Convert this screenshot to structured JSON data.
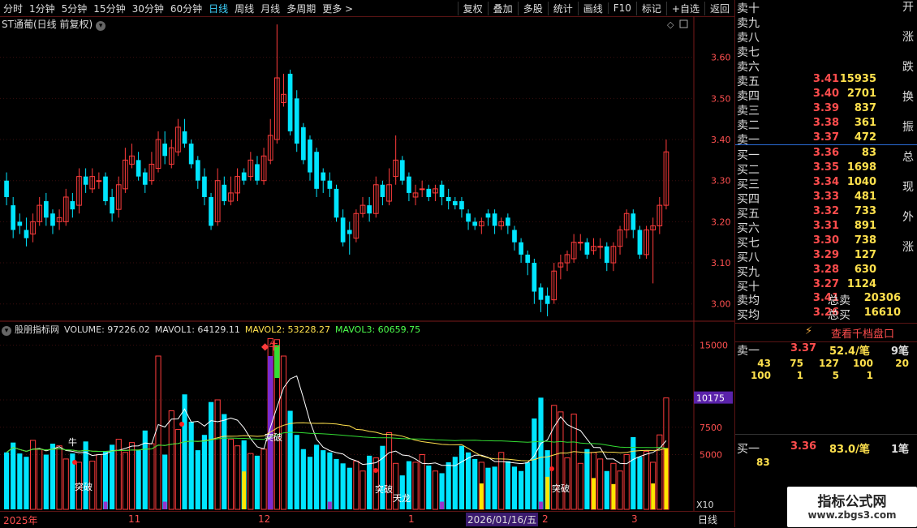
{
  "toolbar": {
    "periods": [
      "分时",
      "1分钟",
      "5分钟",
      "15分钟",
      "30分钟",
      "60分钟",
      "日线",
      "周线",
      "月线",
      "多周期",
      "更多 >"
    ],
    "active": "日线",
    "right": [
      "复权",
      "叠加",
      "多股",
      "统计",
      "画线",
      "F10",
      "标记",
      "+自选",
      "返回"
    ]
  },
  "main_title": "ST通葡(日线 前复权)",
  "indicator": {
    "name": "股朋指标网",
    "volume": "VOLUME: 97226.02",
    "mavol1": "MAVOL1: 64129.11",
    "mavol2": "MAVOL2: 53228.27",
    "mavol3": "MAVOL3: 60659.75",
    "last_value": "10175",
    "axis_unit": "X10"
  },
  "price_axis": [
    "3.60",
    "3.50",
    "3.40",
    "3.30",
    "3.20",
    "3.10",
    "3.00"
  ],
  "vol_axis": [
    "15000",
    "10000",
    "7500",
    "5000"
  ],
  "orderbook": {
    "asks": [
      {
        "label": "卖十",
        "price": "",
        "vol": ""
      },
      {
        "label": "卖九",
        "price": "",
        "vol": ""
      },
      {
        "label": "卖八",
        "price": "",
        "vol": ""
      },
      {
        "label": "卖七",
        "price": "",
        "vol": ""
      },
      {
        "label": "卖六",
        "price": "",
        "vol": ""
      },
      {
        "label": "卖五",
        "price": "3.41",
        "vol": "15935"
      },
      {
        "label": "卖四",
        "price": "3.40",
        "vol": "2701"
      },
      {
        "label": "卖三",
        "price": "3.39",
        "vol": "837"
      },
      {
        "label": "卖二",
        "price": "3.38",
        "vol": "361"
      },
      {
        "label": "卖一",
        "price": "3.37",
        "vol": "472"
      }
    ],
    "bids": [
      {
        "label": "买一",
        "price": "3.36",
        "vol": "83"
      },
      {
        "label": "买二",
        "price": "3.35",
        "vol": "1698"
      },
      {
        "label": "买三",
        "price": "3.34",
        "vol": "1040"
      },
      {
        "label": "买四",
        "price": "3.33",
        "vol": "481"
      },
      {
        "label": "买五",
        "price": "3.32",
        "vol": "733"
      },
      {
        "label": "买六",
        "price": "3.31",
        "vol": "891"
      },
      {
        "label": "买七",
        "price": "3.30",
        "vol": "738"
      },
      {
        "label": "买八",
        "price": "3.29",
        "vol": "127"
      },
      {
        "label": "买九",
        "price": "3.28",
        "vol": "630"
      },
      {
        "label": "买十",
        "price": "3.27",
        "vol": "1124"
      }
    ],
    "ask_avg": {
      "label": "卖均",
      "price": "3.41",
      "total_label": "总卖",
      "total": "20306"
    },
    "bid_avg": {
      "label": "买均",
      "price": "3.26",
      "total_label": "总买",
      "total": "16610"
    },
    "view_button": "查看千档盘口",
    "sell1": {
      "label": "卖一",
      "price": "3.37",
      "per": "52.4/笔",
      "count": "9笔",
      "orders_row1": [
        "43",
        "75",
        "127",
        "100",
        "20"
      ],
      "orders_row2": [
        "100",
        "1",
        "5",
        "1"
      ]
    },
    "buy1": {
      "label": "买一",
      "price": "3.36",
      "per": "83.0/笔",
      "count": "1笔",
      "orders_row1": [
        "83"
      ]
    }
  },
  "side_text": "开涨跌换振总现外涨",
  "dates": {
    "y2025": "2025年",
    "m11": "11",
    "m12": "12",
    "m1": "1",
    "hl": "2026/01/16/五",
    "m2": "2",
    "m3": "3",
    "kday": "日线"
  },
  "signals": {
    "niu": "牛",
    "tupo": "突破",
    "tianlong": "天龙"
  },
  "watermark": {
    "title": "指标公式网",
    "url": "www.zbgs3.com"
  },
  "chart_data": {
    "type": "candlestick",
    "open": [
      3.3,
      3.24,
      3.2,
      3.18,
      3.17,
      3.2,
      3.25,
      3.22,
      3.2,
      3.2,
      3.25,
      3.24,
      3.31,
      3.28,
      3.3,
      3.31,
      3.26,
      3.23,
      3.28,
      3.34,
      3.35,
      3.32,
      3.3,
      3.33,
      3.39,
      3.34,
      3.37,
      3.42,
      3.39,
      3.35,
      3.31,
      3.26,
      3.2,
      3.29,
      3.25,
      3.27,
      3.32,
      3.31,
      3.34,
      3.3,
      3.35,
      3.4,
      3.49,
      3.56,
      3.5,
      3.43,
      3.4,
      3.37,
      3.32,
      3.3,
      3.28,
      3.21,
      3.18,
      3.16,
      3.22,
      3.24,
      3.22,
      3.29,
      3.25,
      3.31,
      3.35,
      3.31,
      3.26,
      3.28,
      3.28,
      3.27,
      3.29,
      3.26,
      3.25,
      3.25,
      3.22,
      3.2,
      3.19,
      3.22,
      3.22,
      3.19,
      3.21,
      3.18,
      3.15,
      3.12,
      3.1,
      3.04,
      3.02,
      3.01,
      3.09,
      3.1,
      3.11,
      3.15,
      3.15,
      3.13,
      3.14,
      3.14,
      3.1,
      3.14,
      3.18,
      3.22,
      3.18,
      3.12,
      3.18,
      3.19,
      3.24
    ],
    "close": [
      3.26,
      3.18,
      3.19,
      3.16,
      3.2,
      3.24,
      3.21,
      3.19,
      3.21,
      3.26,
      3.23,
      3.31,
      3.29,
      3.31,
      3.3,
      3.25,
      3.22,
      3.29,
      3.35,
      3.36,
      3.31,
      3.29,
      3.34,
      3.4,
      3.36,
      3.38,
      3.43,
      3.39,
      3.34,
      3.3,
      3.26,
      3.19,
      3.3,
      3.25,
      3.27,
      3.31,
      3.3,
      3.35,
      3.3,
      3.36,
      3.41,
      3.55,
      3.51,
      3.42,
      3.39,
      3.35,
      3.32,
      3.28,
      3.3,
      3.28,
      3.21,
      3.15,
      3.17,
      3.22,
      3.24,
      3.22,
      3.29,
      3.26,
      3.29,
      3.35,
      3.3,
      3.27,
      3.27,
      3.28,
      3.26,
      3.28,
      3.26,
      3.25,
      3.24,
      3.23,
      3.2,
      3.19,
      3.2,
      3.21,
      3.19,
      3.2,
      3.19,
      3.15,
      3.12,
      3.1,
      3.03,
      3.01,
      3.0,
      3.08,
      3.1,
      3.12,
      3.15,
      3.15,
      3.12,
      3.14,
      3.14,
      3.1,
      3.14,
      3.18,
      3.22,
      3.18,
      3.12,
      3.18,
      3.19,
      3.24,
      3.37
    ],
    "high": [
      3.32,
      3.26,
      3.22,
      3.21,
      3.22,
      3.26,
      3.27,
      3.23,
      3.23,
      3.28,
      3.27,
      3.33,
      3.33,
      3.33,
      3.32,
      3.32,
      3.28,
      3.31,
      3.38,
      3.39,
      3.37,
      3.33,
      3.37,
      3.42,
      3.42,
      3.4,
      3.45,
      3.45,
      3.4,
      3.36,
      3.33,
      3.27,
      3.33,
      3.31,
      3.31,
      3.33,
      3.33,
      3.37,
      3.36,
      3.38,
      3.45,
      3.68,
      3.56,
      3.57,
      3.52,
      3.44,
      3.41,
      3.38,
      3.33,
      3.32,
      3.29,
      3.23,
      3.2,
      3.23,
      3.26,
      3.26,
      3.31,
      3.3,
      3.33,
      3.41,
      3.36,
      3.32,
      3.29,
      3.3,
      3.29,
      3.29,
      3.3,
      3.28,
      3.26,
      3.26,
      3.23,
      3.21,
      3.21,
      3.23,
      3.23,
      3.21,
      3.22,
      3.19,
      3.16,
      3.13,
      3.11,
      3.05,
      3.04,
      3.1,
      3.12,
      3.13,
      3.17,
      3.17,
      3.16,
      3.16,
      3.16,
      3.15,
      3.15,
      3.19,
      3.23,
      3.23,
      3.19,
      3.19,
      3.21,
      3.26,
      3.4
    ],
    "low": [
      3.24,
      3.16,
      3.17,
      3.14,
      3.15,
      3.19,
      3.19,
      3.17,
      3.18,
      3.19,
      3.21,
      3.22,
      3.27,
      3.27,
      3.28,
      3.24,
      3.2,
      3.21,
      3.27,
      3.33,
      3.3,
      3.27,
      3.29,
      3.32,
      3.34,
      3.33,
      3.36,
      3.38,
      3.33,
      3.28,
      3.24,
      3.18,
      3.19,
      3.24,
      3.24,
      3.25,
      3.29,
      3.3,
      3.29,
      3.29,
      3.34,
      3.39,
      3.48,
      3.41,
      3.37,
      3.34,
      3.3,
      3.26,
      3.27,
      3.26,
      3.2,
      3.14,
      3.12,
      3.15,
      3.21,
      3.2,
      3.21,
      3.24,
      3.24,
      3.29,
      3.29,
      3.25,
      3.24,
      3.26,
      3.25,
      3.25,
      3.24,
      3.23,
      3.23,
      3.21,
      3.18,
      3.18,
      3.17,
      3.19,
      3.17,
      3.18,
      3.17,
      3.13,
      3.1,
      3.07,
      3.0,
      2.98,
      2.97,
      3.0,
      3.06,
      3.08,
      3.1,
      3.13,
      3.11,
      3.12,
      3.11,
      3.08,
      3.08,
      3.12,
      3.16,
      3.16,
      3.11,
      3.11,
      3.05,
      3.17,
      3.23
    ],
    "volume": [
      5200,
      6100,
      5100,
      4800,
      6300,
      5500,
      5000,
      6000,
      5800,
      4600,
      5100,
      4300,
      6200,
      4400,
      5000,
      5300,
      5900,
      6400,
      5200,
      6100,
      5400,
      7200,
      6000,
      14000,
      5000,
      9000,
      7300,
      10500,
      8000,
      5400,
      6800,
      9800,
      10000,
      8700,
      6400,
      5800,
      6300,
      5100,
      4900,
      5500,
      15600,
      15500,
      14000,
      9000,
      6800,
      5500,
      4800,
      5900,
      5400,
      5200,
      4600,
      4200,
      3800,
      4400,
      3500,
      4900,
      4700,
      5800,
      7000,
      4200,
      3100,
      4400,
      4300,
      5000,
      4000,
      3500,
      3300,
      4300,
      4800,
      5800,
      5200,
      4600,
      4300,
      3800,
      3900,
      5200,
      4400,
      3900,
      3500,
      4300,
      8300,
      10200,
      5400,
      9500,
      8900,
      4700,
      8700,
      4200,
      5500,
      5200,
      4600,
      3500,
      4200,
      3500,
      5000,
      6600,
      4800,
      5300,
      4300,
      6800,
      10175
    ]
  }
}
